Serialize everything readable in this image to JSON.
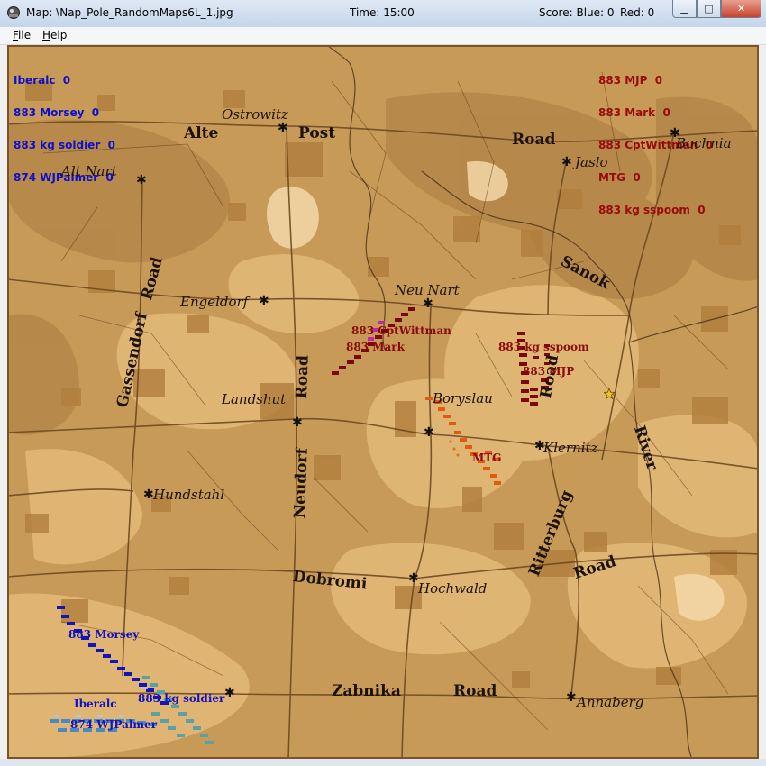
{
  "window": {
    "title": "Map: \\Nap_Pole_RandomMaps6L_1.jpg",
    "time": "Time: 15:00",
    "score_blue": "Score: Blue: 0",
    "score_red": "Red: 0",
    "minimize_glyph": "▁",
    "maximize_glyph": "□",
    "close_glyph": "✕"
  },
  "menu": {
    "file": "File",
    "help": "Help"
  },
  "colors": {
    "blue_team": "#1010c8",
    "red_team": "#9a0a0a",
    "map_base": "#c89a58"
  },
  "blue_roster": [
    "Iberalc  0",
    "883 Morsey  0",
    "883 kg soldier  0",
    "874 WJPalmer  0"
  ],
  "red_roster": [
    "883 MJP  0",
    "883 Mark  0",
    "883 CptWittman  0",
    "MTG  0",
    "883 kg sspoom  0"
  ],
  "places": {
    "ostrowitz": "Ostrowitz",
    "alte": "Alte",
    "post": "Post",
    "road_n": "Road",
    "jaslo": "Jaslo",
    "bochnia": "Bochnia",
    "alt_nart": "Alt Nart",
    "sanok": "Sanok",
    "road_w": "Road",
    "engeldorf": "Engeldorf",
    "neu_nart": "Neu Nart",
    "gassendorf": "Gassendorf",
    "road_c": "Road",
    "landshut": "Landshut",
    "boryslau": "Boryslau",
    "klernitz": "Klernitz",
    "river": "River",
    "road_e": "Road",
    "hundstahl": "Hundstahl",
    "neudorf": "Neudorf",
    "ritterburg": "Ritterburg",
    "road_se": "Road",
    "dobromi": "Dobromi",
    "hochwald": "Hochwald",
    "zabnika": "Zabnika",
    "road_s": "Road",
    "annaberg": "Annaberg"
  },
  "units": {
    "cptwittman": "883 CptWittman",
    "mark": "883 Mark",
    "sspoom": "883 kg sspoom",
    "mjp": "883 MJP",
    "mtg": "MTG",
    "morsey": "883 Morsey",
    "iberalc": "Iberalc",
    "soldier": "883 kg soldier",
    "wjpalmer": "874 WJPalmer"
  },
  "objective_icon": "star-icon"
}
